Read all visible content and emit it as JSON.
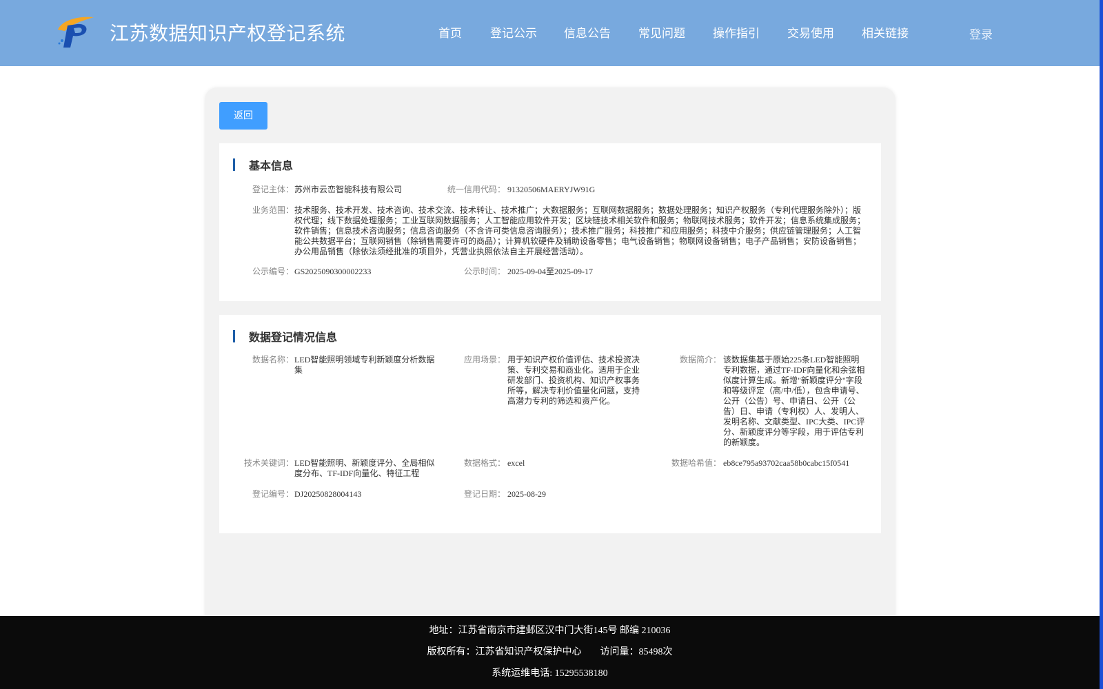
{
  "header": {
    "logo_alt": "logo",
    "title": "江苏数据知识产权登记系统",
    "nav": [
      "首页",
      "登记公示",
      "信息公告",
      "常见问题",
      "操作指引",
      "交易使用",
      "相关链接"
    ],
    "login": "登录"
  },
  "colors": {
    "header_bg": "#78a9de",
    "primary_button": "#409eff",
    "section_bar": "#1e5ea8",
    "footer_bg": "#0b0b0b"
  },
  "main": {
    "back_label": "返回",
    "basic": {
      "title": "基本信息",
      "subject_label": "登记主体：",
      "subject_value": "苏州市云峦智能科技有限公司",
      "credit_label": "统一信用代码：",
      "credit_value": "91320506MAERYJW91G",
      "scope_label": "业务范围：",
      "scope_value": "技术服务、技术开发、技术咨询、技术交流、技术转让、技术推广；大数据服务；互联网数据服务；数据处理服务；知识产权服务（专利代理服务除外）；版权代理；线下数据处理服务；工业互联网数据服务；人工智能应用软件开发；区块链技术相关软件和服务；物联网技术服务；软件开发；信息系统集成服务；软件销售；信息技术咨询服务；信息咨询服务（不含许可类信息咨询服务）；技术推广服务；科技推广和应用服务；科技中介服务；供应链管理服务；人工智能公共数据平台；互联网销售（除销售需要许可的商品）；计算机软硬件及辅助设备零售；电气设备销售；物联网设备销售；电子产品销售；安防设备销售；办公用品销售（除依法须经批准的项目外，凭营业执照依法自主开展经营活动）。",
      "pub_no_label": "公示编号：",
      "pub_no_value": "GS2025090300002233",
      "pub_time_label": "公示时间：",
      "pub_time_value": "2025-09-04至2025-09-17"
    },
    "reg": {
      "title": "数据登记情况信息",
      "name_label": "数据名称：",
      "name_value": "LED智能照明领域专利新颖度分析数据集",
      "scene_label": "应用场景：",
      "scene_value": "用于知识产权价值评估、技术投资决策、专利交易和商业化。适用于企业研发部门、投资机构、知识产权事务所等，解决专利价值量化问题，支持高潜力专利的筛选和资产化。",
      "intro_label": "数据简介：",
      "intro_value": "该数据集基于原始225条LED智能照明专利数据，通过TF-IDF向量化和余弦相似度计算生成。新增\"新颖度评分\"字段和等级评定（高/中/低），包含申请号、公开（公告）号、申请日、公开（公告）日、申请（专利权）人、发明人、发明名称、文献类型、IPC大类、IPC评分、新颖度评分等字段，用于评估专利的新颖度。",
      "keywords_label": "技术关键词：",
      "keywords_value": "LED智能照明、新颖度评分、全局相似度分布、TF-IDF向量化、特征工程",
      "format_label": "数据格式：",
      "format_value": "excel",
      "hash_label": "数据哈希值：",
      "hash_value": "eb8ce795a93702caa58b0cabc15f0541",
      "reg_no_label": "登记编号：",
      "reg_no_value": "DJ20250828004143",
      "reg_date_label": "登记日期：",
      "reg_date_value": "2025-08-29"
    }
  },
  "footer": {
    "address": "地址：江苏省南京市建邺区汉中门大街145号 邮编 210036",
    "copyright": "版权所有：江苏省知识产权保护中心",
    "visits": "访问量：85498次",
    "phone": "系统运维电话: 15295538180"
  }
}
